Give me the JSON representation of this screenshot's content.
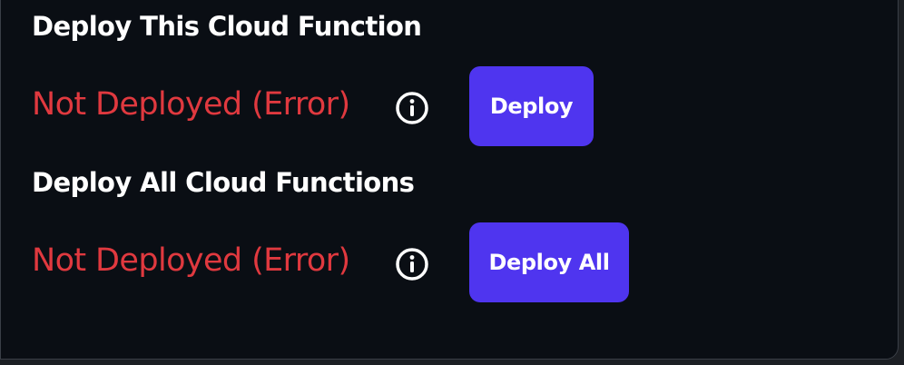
{
  "deploy_single": {
    "title": "Deploy This Cloud Function",
    "status": "Not Deployed (Error)",
    "button_label": "Deploy"
  },
  "deploy_all": {
    "title": "Deploy All Cloud Functions",
    "status": "Not Deployed (Error)",
    "button_label": "Deploy All"
  },
  "colors": {
    "panel_bg": "#0a0e14",
    "error_text": "#e0393f",
    "button_bg": "#4f35ef",
    "title_text": "#ffffff"
  },
  "icons": {
    "status_info": "info-circle-icon"
  }
}
